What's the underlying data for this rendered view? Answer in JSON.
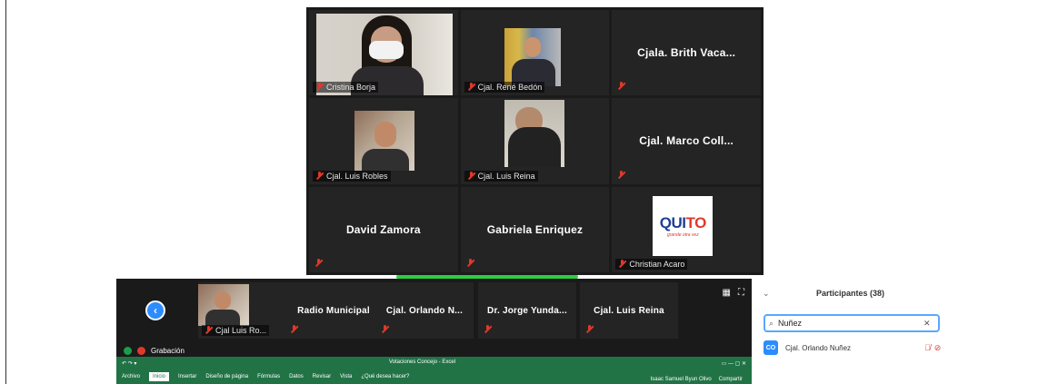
{
  "gallery": {
    "tiles": [
      {
        "label": "Cristina Borja"
      },
      {
        "label": "Cjal. René Bedón"
      },
      {
        "label": "Cjala. Brith Vaca..."
      },
      {
        "label": "Cjal. Luis Robles"
      },
      {
        "label": "Cjal. Luis Reina"
      },
      {
        "label": "Cjal. Marco Coll..."
      },
      {
        "label": "David Zamora"
      },
      {
        "label": "Gabriela Enriquez"
      },
      {
        "label": "Christian Acaro",
        "logo_main": "QUITO",
        "logo_part1": "QUI",
        "logo_part2": "TO",
        "logo_sub": "grande otra vez"
      }
    ]
  },
  "strip": {
    "back_icon": "chevron-left-icon",
    "tiles": [
      {
        "label": "Cjal Luis Ro..."
      },
      {
        "label": "Radio Municipal"
      },
      {
        "label": "Cjal. Orlando N..."
      },
      {
        "label": "Dr. Jorge Yunda..."
      },
      {
        "label": "Cjal. Luis Reina"
      }
    ]
  },
  "recording": {
    "label": "Grabación"
  },
  "excel": {
    "title": "Votaciones Concejo - Excel",
    "menu": [
      "Archivo",
      "Inicio",
      "Insertar",
      "Diseño de página",
      "Fórmulas",
      "Datos",
      "Revisar",
      "Vista",
      "¿Qué desea hacer?"
    ],
    "user": "Isaac Samuel Byun Olivo",
    "share": "Compartir"
  },
  "participants": {
    "title": "Participantes (38)",
    "search_value": "Nuñez",
    "items": [
      {
        "initials": "CO",
        "name": "Cjal. Orlando Nuñez"
      }
    ]
  },
  "colors": {
    "zoom_blue": "#2d8cff",
    "muted_red": "#e0392b",
    "excel_green": "#217346",
    "active_speaker": "#2ecc40"
  }
}
